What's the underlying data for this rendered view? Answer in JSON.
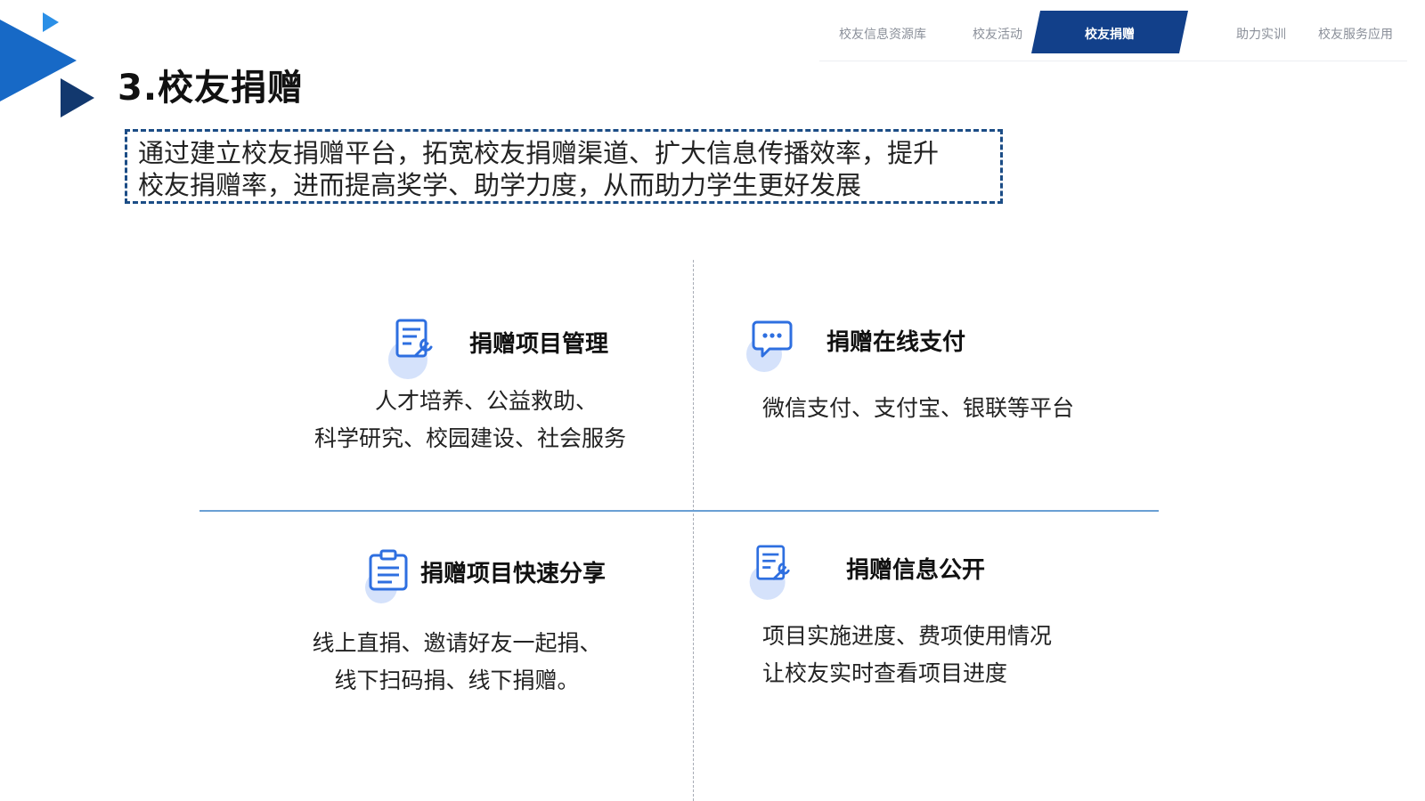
{
  "colors": {
    "brand_blue": "#1769c6",
    "brand_dark": "#12386e",
    "nav_active_bg": "#12408a",
    "dashed_border": "#1c4d86",
    "divider_blue": "#6a9fd4",
    "icon_blue": "#2e6fe0",
    "icon_halo": "#d5e2fb"
  },
  "nav": {
    "items": [
      {
        "label": "校友信息资源库",
        "active": false
      },
      {
        "label": "校友活动",
        "active": false
      },
      {
        "label": "校友捐赠",
        "active": true
      },
      {
        "label": "助力实训",
        "active": false
      },
      {
        "label": "校友服务应用",
        "active": false
      }
    ]
  },
  "page": {
    "title": "3.校友捐赠",
    "intro_lines": [
      "通过建立校友捐赠平台，拓宽校友捐赠渠道、扩大信息传播效率，提升",
      "校友捐赠率，进而提高奖学、助学力度，从而助力学生更好发展"
    ]
  },
  "cards": [
    {
      "icon": "document-wrench-icon",
      "title": "捐赠项目管理",
      "desc_lines": [
        "人才培养、公益救助、",
        "科学研究、校园建设、社会服务"
      ]
    },
    {
      "icon": "chat-bubble-icon",
      "title": "捐赠在线支付",
      "desc_lines": [
        "微信支付、支付宝、银联等平台"
      ]
    },
    {
      "icon": "clipboard-list-icon",
      "title": "捐赠项目快速分享",
      "desc_lines": [
        "线上直捐、邀请好友一起捐、",
        "线下扫码捐、线下捐赠。"
      ]
    },
    {
      "icon": "document-wrench-icon",
      "title": "捐赠信息公开",
      "desc_lines": [
        "项目实施进度、费项使用情况",
        "让校友实时查看项目进度"
      ]
    }
  ]
}
